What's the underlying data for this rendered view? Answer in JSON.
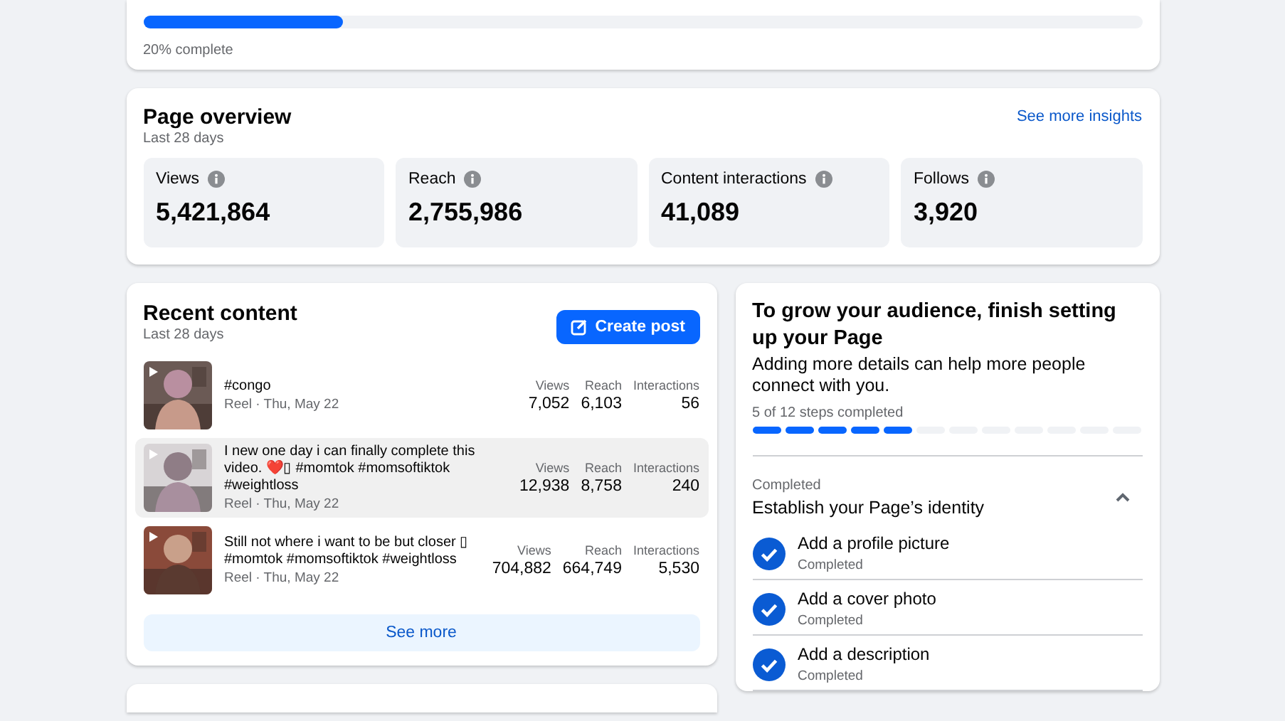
{
  "setup_progress": {
    "level": 0.2,
    "label": "20% complete"
  },
  "overview": {
    "title": "Page overview",
    "subtitle": "Last 28 days",
    "link": "See more insights",
    "metrics": [
      {
        "label": "Views",
        "value": "5,421,864"
      },
      {
        "label": "Reach",
        "value": "2,755,986"
      },
      {
        "label": "Content interactions",
        "value": "41,089"
      },
      {
        "label": "Follows",
        "value": "3,920"
      }
    ]
  },
  "recent_content": {
    "title": "Recent content",
    "subtitle": "Last 28 days",
    "create_button": "Create post",
    "posts": [
      {
        "caption": "#congo",
        "meta": "Reel · Thu, May 22",
        "stats": [
          {
            "label": "Views",
            "value": "7,052"
          },
          {
            "label": "Reach",
            "value": "6,103"
          },
          {
            "label": "Interactions",
            "value": "56"
          }
        ],
        "selected": false,
        "kind": "picture"
      },
      {
        "caption": "I new one day i can finally complete this video. ❤️▯ #momtok #momsoftiktok #weightloss",
        "meta": "Reel · Thu, May 22",
        "stats": [
          {
            "label": "Views",
            "value": "12,938"
          },
          {
            "label": "Reach",
            "value": "8,758"
          },
          {
            "label": "Interactions",
            "value": "240"
          }
        ],
        "selected": true,
        "kind": "picture"
      },
      {
        "caption": "Still not where i want to be but closer ▯ #momtok #momsoftiktok #weightloss",
        "meta": "Reel · Thu, May 22",
        "stats": [
          {
            "label": "Views",
            "value": "704,882"
          },
          {
            "label": "Reach",
            "value": "664,749"
          },
          {
            "label": "Interactions",
            "value": "5,530"
          }
        ],
        "selected": false,
        "kind": "picture"
      }
    ],
    "see_more": "See more"
  },
  "grow": {
    "title": "To grow your audience, finish setting up your Page",
    "description": "Adding more details can help more people connect with you.",
    "steps_label": "5 of 12 steps completed",
    "steps": [
      {
        "completed": true
      },
      {
        "completed": true
      },
      {
        "completed": true
      },
      {
        "completed": true
      },
      {
        "completed": true
      },
      {
        "completed": false
      },
      {
        "completed": false
      },
      {
        "completed": false
      },
      {
        "completed": false
      },
      {
        "completed": false
      },
      {
        "completed": false
      },
      {
        "completed": false
      }
    ],
    "section": {
      "status": "Completed",
      "title": "Establish your Page’s identity",
      "expanded": true,
      "items": [
        {
          "title": "Add a profile picture",
          "status": "Completed",
          "completed": true
        },
        {
          "title": "Add a cover photo",
          "status": "Completed",
          "completed": true
        },
        {
          "title": "Add a description",
          "status": "Completed",
          "completed": true
        }
      ]
    }
  }
}
